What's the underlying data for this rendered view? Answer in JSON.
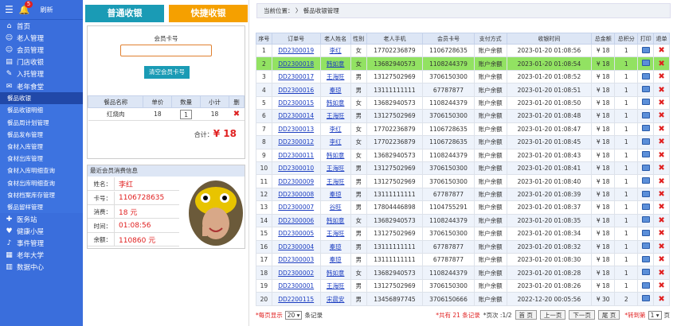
{
  "header": {
    "badge": "5",
    "refresh": "刷新"
  },
  "sidebar": {
    "items": [
      {
        "icon": "home-icon",
        "glyph": "⌂",
        "label": "首页"
      },
      {
        "icon": "user-icon",
        "glyph": "☺",
        "label": "老人管理"
      },
      {
        "icon": "member-icon",
        "glyph": "☺",
        "label": "会员管理"
      },
      {
        "icon": "register-icon",
        "glyph": "▤",
        "label": "门店收银"
      },
      {
        "icon": "admit-icon",
        "glyph": "✎",
        "label": "入托管理"
      },
      {
        "icon": "canteen-icon",
        "glyph": "✉",
        "label": "老年食堂"
      }
    ],
    "subitems": [
      "餐品收银",
      "餐品收银明细",
      "餐品周计划管理",
      "餐品发布管理",
      "食材入库管理",
      "食材出库管理",
      "食材入库明细查询",
      "食材出库明细查询",
      "食材档案库存管理",
      "餐品留样管理"
    ],
    "items2": [
      {
        "icon": "medical-icon",
        "glyph": "✚",
        "label": "医务站"
      },
      {
        "icon": "health-icon",
        "glyph": "♥",
        "label": "健康小屋"
      },
      {
        "icon": "event-icon",
        "glyph": "♪",
        "label": "事件管理"
      },
      {
        "icon": "university-icon",
        "glyph": "▦",
        "label": "老年大学"
      },
      {
        "icon": "data-icon",
        "glyph": "▥",
        "label": "数据中心"
      }
    ]
  },
  "pos": {
    "normal_btn": "普通收银",
    "quick_btn": "快捷收银",
    "card_label": "会员卡号",
    "clear_btn": "清空会员卡号",
    "order_headers": [
      "餐品名称",
      "单价",
      "数量",
      "小计",
      "删"
    ],
    "order_rows": [
      {
        "name": "红烧肉",
        "price": "18",
        "qty": "1",
        "subtotal": "18"
      }
    ],
    "total_label": "合计：",
    "total_value": "¥ 18"
  },
  "recent": {
    "title": "最近会员消费信息",
    "rows": [
      {
        "k": "姓名：",
        "v": "李红"
      },
      {
        "k": "卡号：",
        "v": "1106728635"
      },
      {
        "k": "消费：",
        "v": "18 元"
      },
      {
        "k": "时间：",
        "v": "01:08:56"
      },
      {
        "k": "余额：",
        "v": "110860 元"
      }
    ]
  },
  "main": {
    "breadcrumb": "当前位置：  〉 餐品收银管理",
    "headers": [
      "序号",
      "订单号",
      "老人姓名",
      "性别",
      "老人手机",
      "会员卡号",
      "支付方式",
      "收银时间",
      "总金额",
      "总积分",
      "打印",
      "退单"
    ],
    "rows": [
      [
        "1",
        "DD2300019",
        "李红",
        "女",
        "17702236879",
        "1106728635",
        "账户余额",
        "2023-01-20 01:08:56",
        "¥ 18",
        "1"
      ],
      [
        "2",
        "DD2300018",
        "韩如意",
        "女",
        "13682940573",
        "1108244379",
        "账户余额",
        "2023-01-20 01:08:54",
        "¥ 18",
        "1"
      ],
      [
        "3",
        "DD2300017",
        "王海旺",
        "男",
        "13127502969",
        "3706150300",
        "账户余额",
        "2023-01-20 01:08:52",
        "¥ 18",
        "1"
      ],
      [
        "4",
        "DD2300016",
        "秦琼",
        "男",
        "13111111111",
        "67787877",
        "账户余额",
        "2023-01-20 01:08:51",
        "¥ 18",
        "1"
      ],
      [
        "5",
        "DD2300015",
        "韩如意",
        "女",
        "13682940573",
        "1108244379",
        "账户余额",
        "2023-01-20 01:08:50",
        "¥ 18",
        "1"
      ],
      [
        "6",
        "DD2300014",
        "王海旺",
        "男",
        "13127502969",
        "3706150300",
        "账户余额",
        "2023-01-20 01:08:48",
        "¥ 18",
        "1"
      ],
      [
        "7",
        "DD2300013",
        "李红",
        "女",
        "17702236879",
        "1106728635",
        "账户余额",
        "2023-01-20 01:08:47",
        "¥ 18",
        "1"
      ],
      [
        "8",
        "DD2300012",
        "李红",
        "女",
        "17702236879",
        "1106728635",
        "账户余额",
        "2023-01-20 01:08:45",
        "¥ 18",
        "1"
      ],
      [
        "9",
        "DD2300011",
        "韩如意",
        "女",
        "13682940573",
        "1108244379",
        "账户余额",
        "2023-01-20 01:08:43",
        "¥ 18",
        "1"
      ],
      [
        "10",
        "DD2300010",
        "王海旺",
        "男",
        "13127502969",
        "3706150300",
        "账户余额",
        "2023-01-20 01:08:41",
        "¥ 18",
        "1"
      ],
      [
        "11",
        "DD2300009",
        "王海旺",
        "男",
        "13127502969",
        "3706150300",
        "账户余额",
        "2023-01-20 01:08:40",
        "¥ 18",
        "1"
      ],
      [
        "12",
        "DD2300008",
        "秦琼",
        "男",
        "13111111111",
        "67787877",
        "账户余额",
        "2023-01-20 01:08:39",
        "¥ 18",
        "1"
      ],
      [
        "13",
        "DD2300007",
        "谷旺",
        "男",
        "17804446898",
        "1104755291",
        "账户余额",
        "2023-01-20 01:08:37",
        "¥ 18",
        "1"
      ],
      [
        "14",
        "DD2300006",
        "韩如意",
        "女",
        "13682940573",
        "1108244379",
        "账户余额",
        "2023-01-20 01:08:35",
        "¥ 18",
        "1"
      ],
      [
        "15",
        "DD2300005",
        "王海旺",
        "男",
        "13127502969",
        "3706150300",
        "账户余额",
        "2023-01-20 01:08:34",
        "¥ 18",
        "1"
      ],
      [
        "16",
        "DD2300004",
        "秦琼",
        "男",
        "13111111111",
        "67787877",
        "账户余额",
        "2023-01-20 01:08:32",
        "¥ 18",
        "1"
      ],
      [
        "17",
        "DD2300003",
        "秦琼",
        "男",
        "13111111111",
        "67787877",
        "账户余额",
        "2023-01-20 01:08:30",
        "¥ 18",
        "1"
      ],
      [
        "18",
        "DD2300002",
        "韩如意",
        "女",
        "13682940573",
        "1108244379",
        "账户余额",
        "2023-01-20 01:08:28",
        "¥ 18",
        "1"
      ],
      [
        "19",
        "DD2300001",
        "王海旺",
        "男",
        "13127502969",
        "3706150300",
        "账户余额",
        "2023-01-20 01:08:26",
        "¥ 18",
        "1"
      ],
      [
        "20",
        "DD2200115",
        "宋晨安",
        "男",
        "13456897745",
        "3706150666",
        "账户余额",
        "2022-12-20 00:05:56",
        "¥ 30",
        "2"
      ]
    ],
    "pager": {
      "page_size_label": "*每页显示",
      "page_size": "20",
      "per_label": "条记录",
      "total": "*共有 21 条记录",
      "pages": "*页次 :1/2",
      "first": "首 页",
      "prev": "上一页",
      "next": "下一页",
      "last": "尾 页",
      "goto_label": "*转到第",
      "goto_value": "1",
      "goto_unit": "页"
    }
  },
  "colors": {
    "sidebar": "#3a6edc",
    "highlight_row": "#92e262",
    "quick_btn": "#f5a000",
    "normal_btn": "#1a9bb5"
  }
}
